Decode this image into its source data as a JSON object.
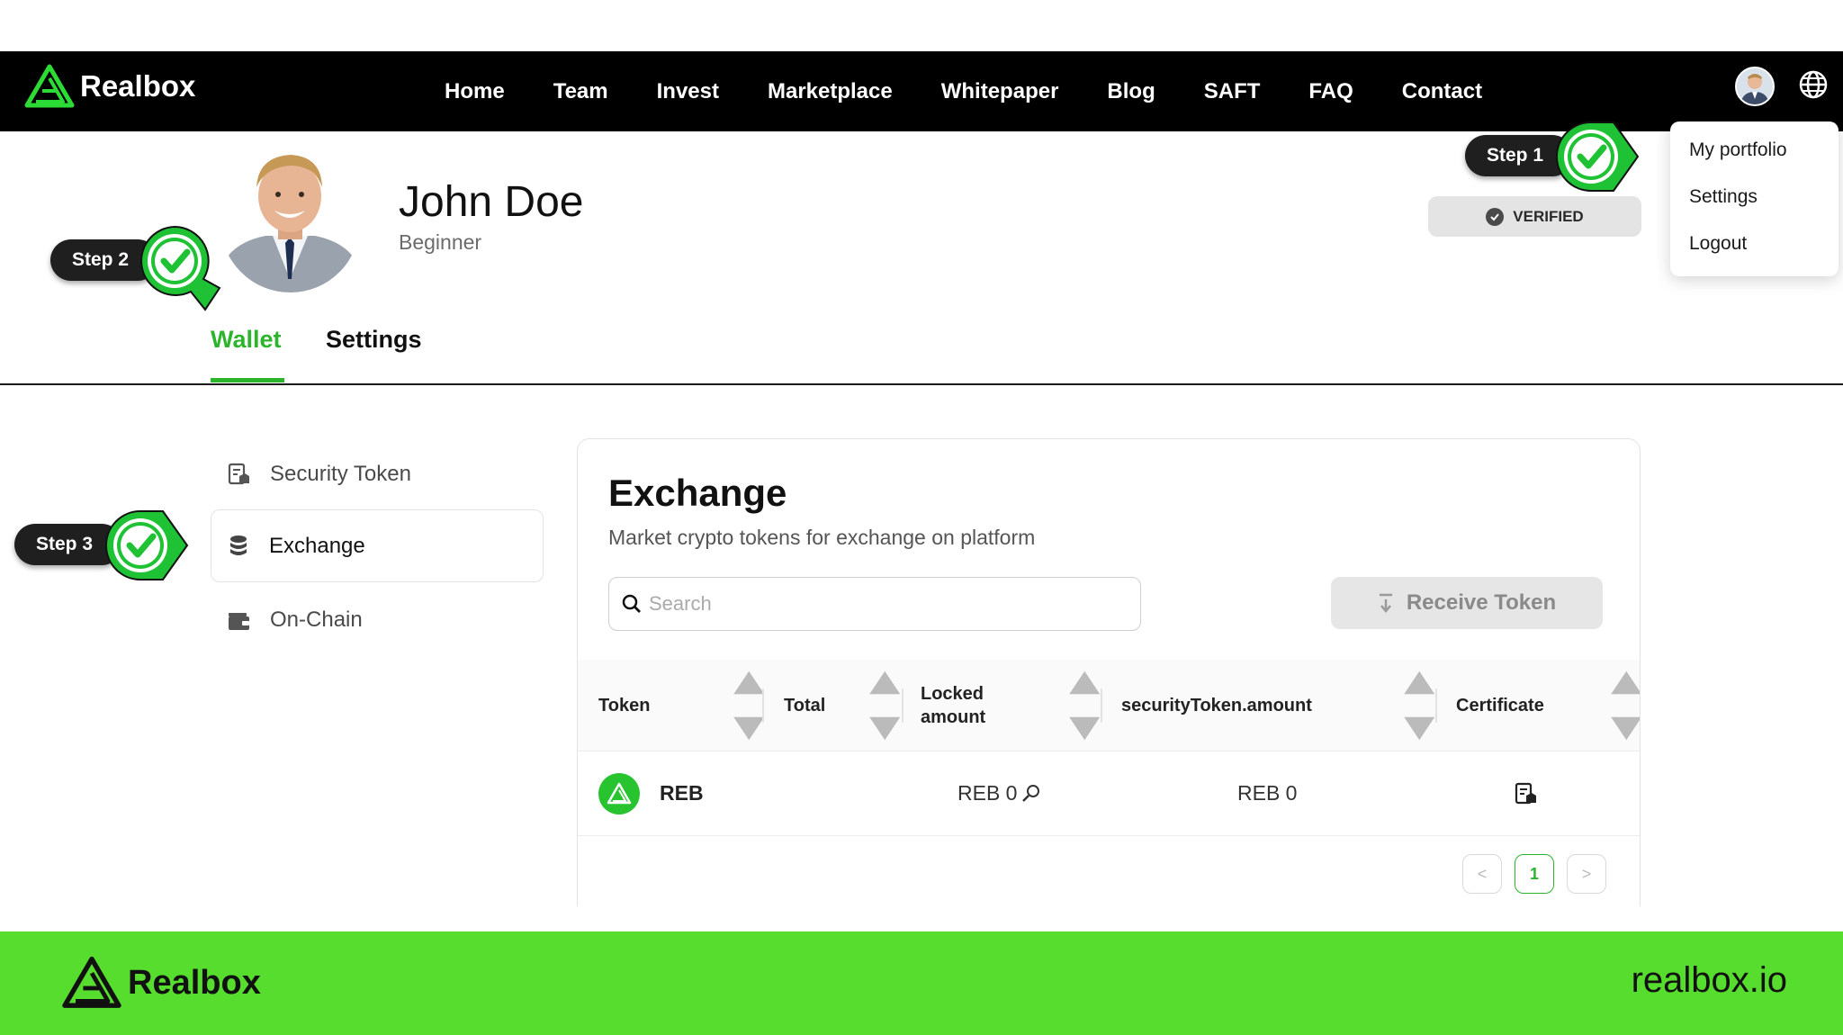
{
  "navbar": {
    "brand": "Realbox",
    "links": [
      "Home",
      "Team",
      "Invest",
      "Marketplace",
      "Whitepaper",
      "Blog",
      "SAFT",
      "FAQ",
      "Contact"
    ]
  },
  "dropdown": {
    "items": [
      "My portfolio",
      "Settings",
      "Logout"
    ]
  },
  "profile": {
    "name": "John Doe",
    "level": "Beginner",
    "badge": "VERIFIED"
  },
  "tabs": {
    "wallet": "Wallet",
    "settings": "Settings"
  },
  "sidebar": {
    "items": [
      {
        "label": "Security Token",
        "icon": "certificate-icon"
      },
      {
        "label": "Exchange",
        "icon": "coins-icon",
        "active": true
      },
      {
        "label": "On-Chain",
        "icon": "wallet-icon"
      }
    ]
  },
  "exchange": {
    "title": "Exchange",
    "subtitle": "Market crypto tokens for exchange on platform",
    "search_placeholder": "Search",
    "receive_label": "Receive Token",
    "columns": [
      "Token",
      "Total",
      "Locked amount",
      "securityToken.amount",
      "Certificate"
    ],
    "rows": [
      {
        "token": "REB",
        "total": "",
        "locked": "REB 0",
        "security_amount": "REB 0",
        "certificate_icon": "certificate-icon"
      }
    ],
    "pagination": {
      "current": "1",
      "prev": "<",
      "next": ">"
    }
  },
  "steps": {
    "step1": "Step 1",
    "step2": "Step 2",
    "step3": "Step 3"
  },
  "footer": {
    "brand": "Realbox",
    "url": "realbox.io"
  },
  "colors": {
    "accent": "#2cb52c",
    "footer_bg": "#56dd2e",
    "navbar_bg": "#000000",
    "step_check": "#1ec234"
  }
}
